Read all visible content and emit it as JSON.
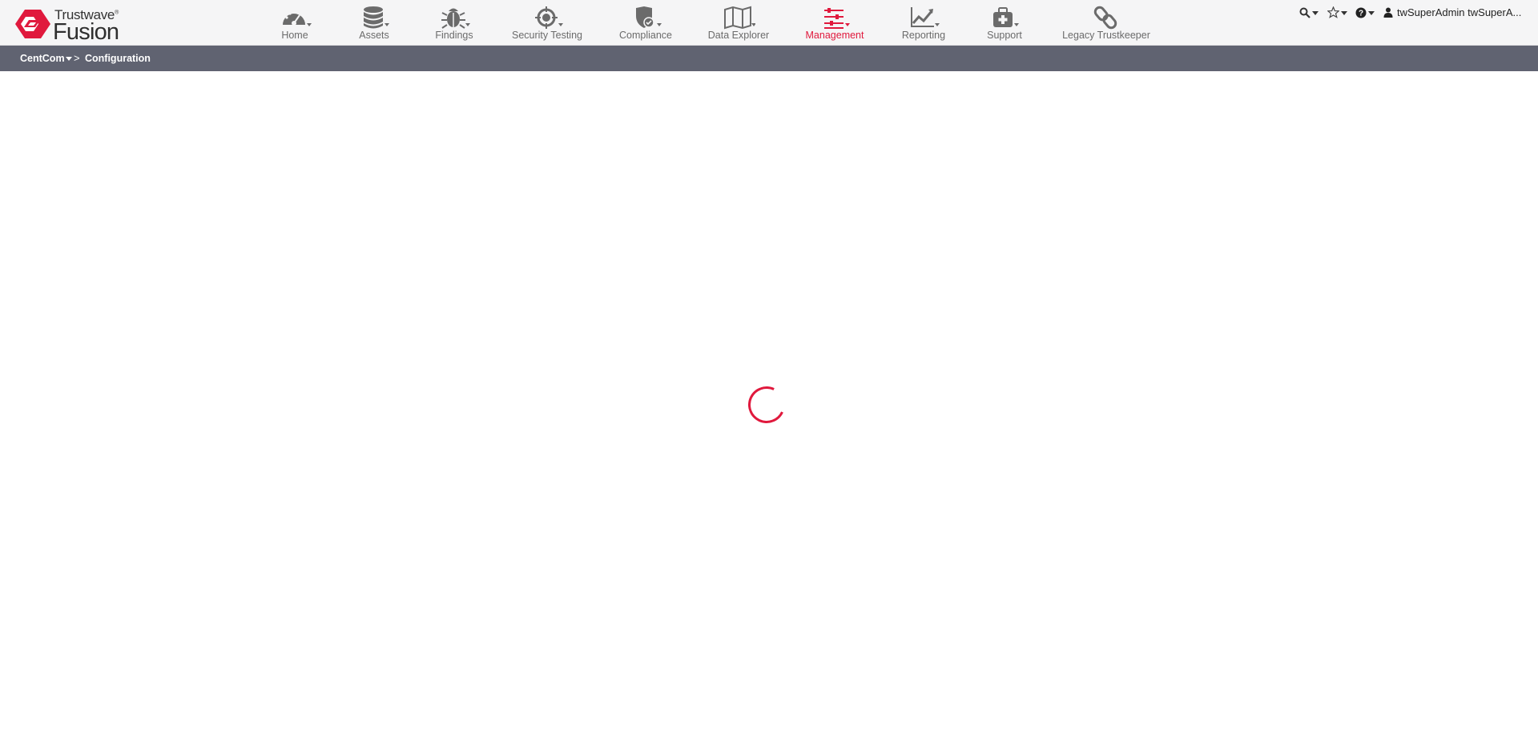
{
  "brand": {
    "name_small": "Trustwave",
    "name_large": "Fusion",
    "accent_color": "#e0193d"
  },
  "nav": [
    {
      "label": "Home",
      "icon": "dashboard-gauge-icon",
      "has_caret": true,
      "active": false
    },
    {
      "label": "Assets",
      "icon": "database-icon",
      "has_caret": true,
      "active": false
    },
    {
      "label": "Findings",
      "icon": "bug-icon",
      "has_caret": true,
      "active": false
    },
    {
      "label": "Security Testing",
      "icon": "crosshair-globe-icon",
      "has_caret": true,
      "active": false
    },
    {
      "label": "Compliance",
      "icon": "shield-check-icon",
      "has_caret": true,
      "active": false
    },
    {
      "label": "Data Explorer",
      "icon": "map-icon",
      "has_caret": true,
      "active": true
    },
    {
      "label": "Management",
      "icon": "sliders-icon",
      "has_caret": true,
      "active": true
    },
    {
      "label": "Reporting",
      "icon": "line-chart-icon",
      "has_caret": true,
      "active": false
    },
    {
      "label": "Support",
      "icon": "first-aid-kit-icon",
      "has_caret": true,
      "active": false
    },
    {
      "label": "Legacy Trustkeeper",
      "icon": "chain-link-icon",
      "has_caret": false,
      "active": false
    }
  ],
  "utility": {
    "search_icon": "search-icon",
    "favorites_icon": "star-icon",
    "help_icon": "help-icon",
    "user_icon": "user-icon",
    "user_name": "twSuperAdmin twSuperA..."
  },
  "breadcrumb": {
    "root": "CentCom",
    "separator": ">",
    "current": "Configuration"
  },
  "status": {
    "loading": true
  }
}
